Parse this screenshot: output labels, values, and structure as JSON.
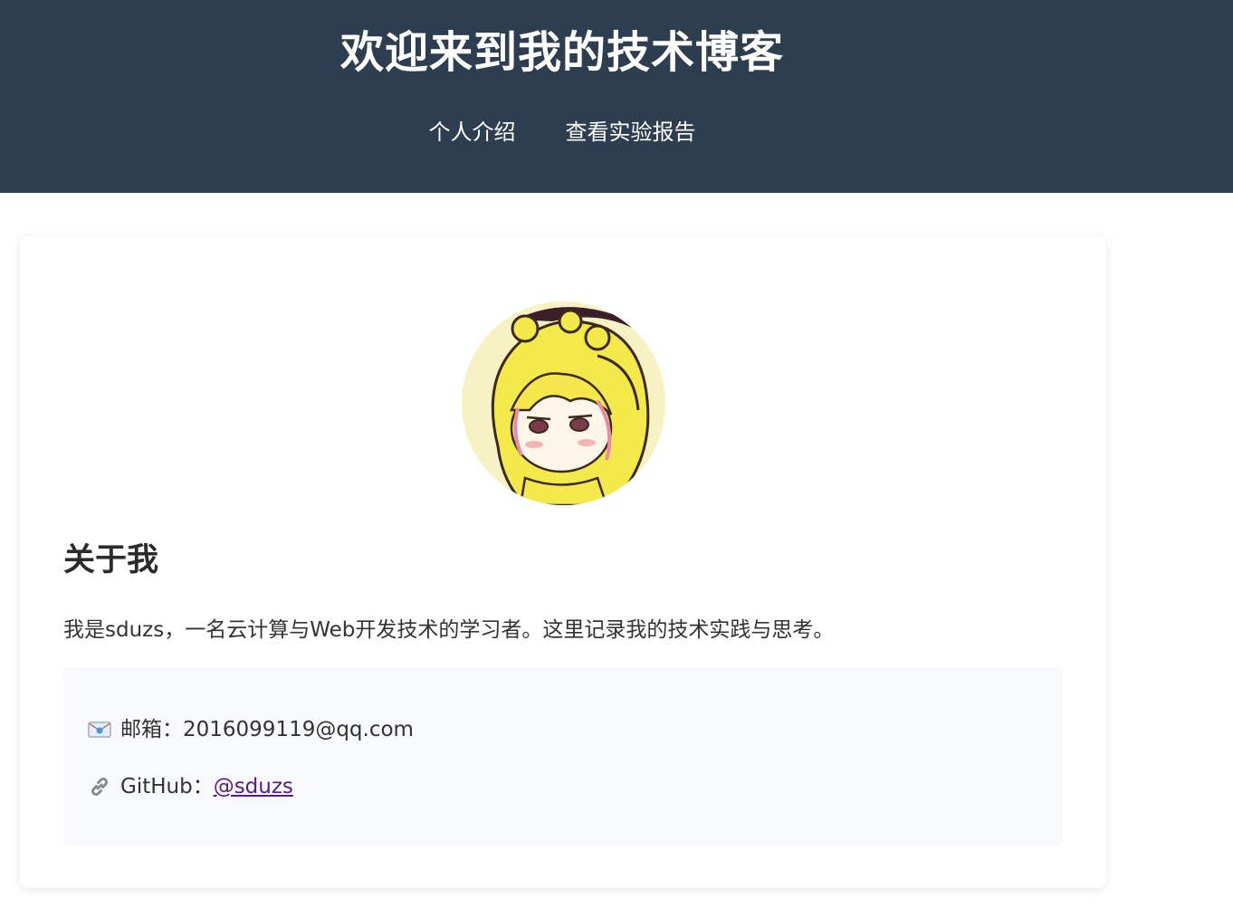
{
  "header": {
    "title": "欢迎来到我的技术博客",
    "nav": [
      {
        "label": "个人介绍"
      },
      {
        "label": "查看实验报告"
      }
    ]
  },
  "about": {
    "title": "关于我",
    "text": "我是sduzs，一名云计算与Web开发技术的学习者。这里记录我的技术实践与思考。"
  },
  "contact": {
    "email": {
      "icon": "envelope-icon",
      "label": "邮箱：",
      "value": "2016099119@qq.com"
    },
    "github": {
      "icon": "link-icon",
      "label": "GitHub：",
      "link_text": "@sduzs"
    }
  },
  "colors": {
    "header_bg": "#2c3e50",
    "link_visited": "#551a8b",
    "contact_bg": "#f8f9fa"
  }
}
